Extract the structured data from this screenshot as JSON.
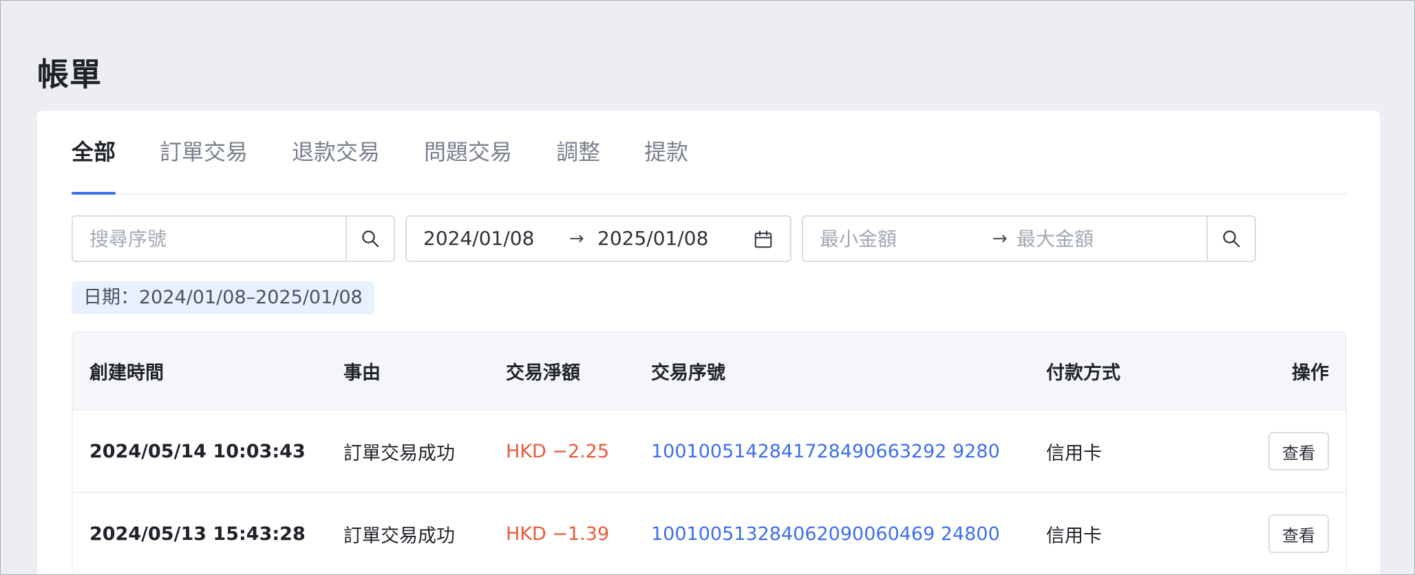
{
  "page": {
    "title": "帳單"
  },
  "tabs": [
    {
      "label": "全部",
      "active": true
    },
    {
      "label": "訂單交易",
      "active": false
    },
    {
      "label": "退款交易",
      "active": false
    },
    {
      "label": "問題交易",
      "active": false
    },
    {
      "label": "調整",
      "active": false
    },
    {
      "label": "提款",
      "active": false
    }
  ],
  "filters": {
    "search": {
      "placeholder": "搜尋序號",
      "icon": "search-icon"
    },
    "date_range": {
      "start": "2024/01/08",
      "separator": "→",
      "end": "2025/01/08",
      "icon": "calendar-icon"
    },
    "amount_range": {
      "min_placeholder": "最小金額",
      "separator": "→",
      "max_placeholder": "最大金額",
      "icon": "search-icon"
    }
  },
  "active_filter": {
    "label": "日期：2024/01/08–2025/01/08"
  },
  "table": {
    "columns": {
      "created_time": "創建時間",
      "reason": "事由",
      "net_amount": "交易淨額",
      "serial": "交易序號",
      "payment": "付款方式",
      "action": "操作"
    },
    "rows": [
      {
        "created_time": "2024/05/14 10:03:43",
        "reason": "訂單交易成功",
        "net_amount": "HKD −2.25",
        "serial": "1001005142841728490663292 9280",
        "payment": "信用卡",
        "action_label": "查看"
      },
      {
        "created_time": "2024/05/13 15:43:28",
        "reason": "訂單交易成功",
        "net_amount": "HKD −1.39",
        "serial": "100100513284062090060469 24800",
        "payment": "信用卡",
        "action_label": "查看"
      }
    ]
  },
  "colors": {
    "accent": "#3d6fe8",
    "negative_amount": "#e85a3a",
    "tag_background": "#e8f1ff"
  }
}
